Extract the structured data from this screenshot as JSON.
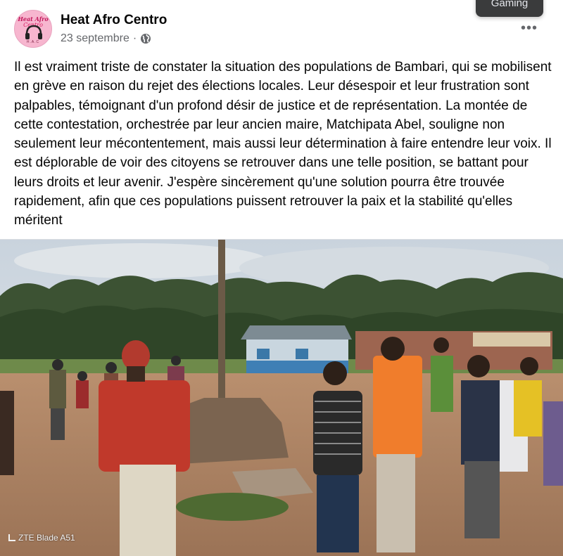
{
  "header": {
    "avatar_top_text": "Heat Afro",
    "avatar_script_text": "Centro",
    "avatar_bottom_text": "H.A.C",
    "page_name": "Heat Afro Centro",
    "date": "23 septembre",
    "separator": "·",
    "privacy_icon": "globe-icon",
    "more_icon": "more-horizontal-icon"
  },
  "tooltip": {
    "label": "Gaming"
  },
  "post": {
    "text": "Il est vraiment triste de constater la situation des populations de Bambari, qui se mobilisent en grève en raison du rejet des élections locales. Leur désespoir et leur frustration sont palpables, témoignant d'un profond désir de justice et de représentation. La montée de cette contestation, orchestrée par leur ancien maire, Matchipata Abel, souligne non seulement leur mécontentement, mais aussi leur détermination à faire entendre leur voix. Il est déplorable de voir des citoyens se retrouver dans une telle position, se battant pour leurs droits et leur avenir. J'espère sincèrement qu'une solution pourra être trouvée rapidement, afin que ces populations puissent retrouver la paix et la stabilité qu'elles méritent"
  },
  "photo": {
    "watermark": "ZTE Blade A51"
  },
  "colors": {
    "text_primary": "#050505",
    "text_secondary": "#65676b",
    "divider": "#dadde1",
    "tooltip_bg": "#3a3b3c"
  }
}
